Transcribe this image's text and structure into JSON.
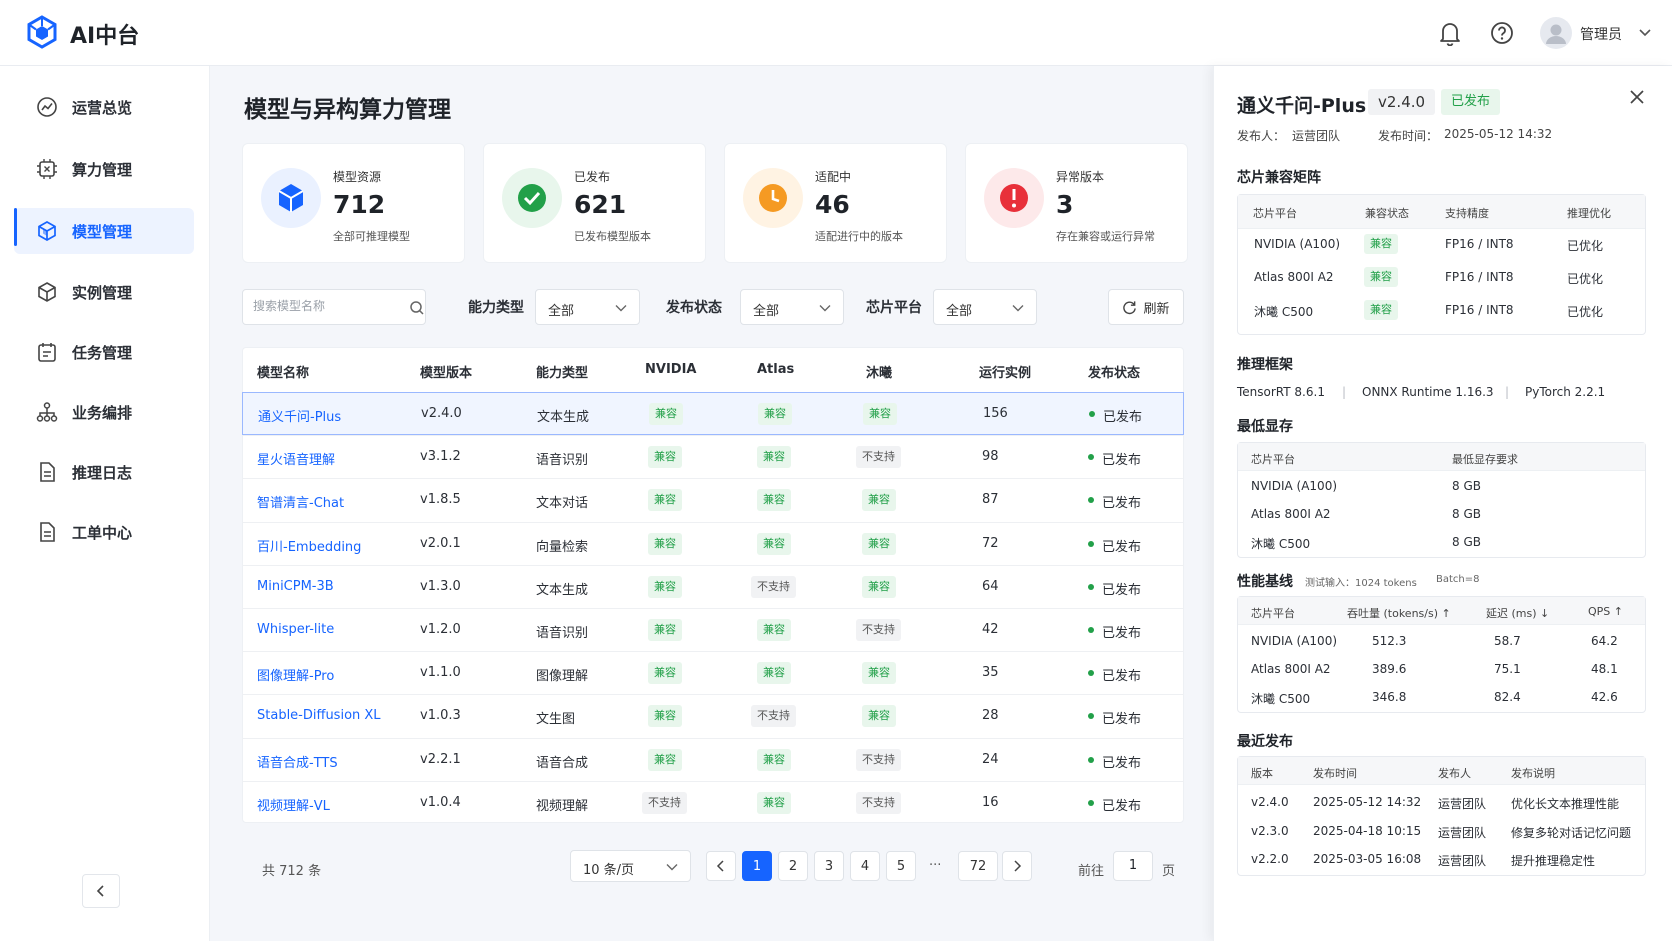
{
  "app": {
    "title": "AI中台"
  },
  "header": {
    "user_name": "管理员"
  },
  "sidebar": {
    "items": [
      {
        "label": "运营总览",
        "icon": "dashboard-icon"
      },
      {
        "label": "算力管理",
        "icon": "chip-icon"
      },
      {
        "label": "模型管理",
        "icon": "model-cube-icon",
        "active": true
      },
      {
        "label": "实例管理",
        "icon": "instance-box-icon"
      },
      {
        "label": "任务管理",
        "icon": "calendar-task-icon"
      },
      {
        "label": "业务编排",
        "icon": "org-chart-icon"
      },
      {
        "label": "推理日志",
        "icon": "document-icon"
      },
      {
        "label": "工单中心",
        "icon": "ticket-icon"
      }
    ]
  },
  "page": {
    "title": "模型与异构算力管理"
  },
  "stats": [
    {
      "label": "模型资源",
      "value": "712",
      "sub": "全部可推理模型",
      "color": "#1664ff",
      "bg": "#eaf1ff"
    },
    {
      "label": "已发布",
      "value": "621",
      "sub": "已发布模型版本",
      "color": "#22a049",
      "bg": "#e8f6ec"
    },
    {
      "label": "适配中",
      "value": "46",
      "sub": "适配进行中的版本",
      "color": "#f59a23",
      "bg": "#fff3e3"
    },
    {
      "label": "异常版本",
      "value": "3",
      "sub": "存在兼容或运行异常",
      "color": "#e8303a",
      "bg": "#fde9ea"
    }
  ],
  "filters": {
    "search_placeholder": "搜索模型名称",
    "ability_label": "能力类型",
    "ability_value": "全部",
    "status_label": "发布状态",
    "status_value": "全部",
    "chip_label": "芯片平台",
    "chip_value": "全部",
    "refresh_label": "刷新"
  },
  "table": {
    "columns": [
      "模型名称",
      "模型版本",
      "能力类型",
      "NVIDIA",
      "Atlas",
      "沐曦",
      "运行实例",
      "发布状态"
    ],
    "rows": [
      {
        "name": "通义千问-Plus",
        "version": "v2.4.0",
        "ability": "文本生成",
        "nvidia": "兼容",
        "atlas": "兼容",
        "muxi": "兼容",
        "instances": "156",
        "status": "已发布"
      },
      {
        "name": "星火语音理解",
        "version": "v3.1.2",
        "ability": "语音识别",
        "nvidia": "兼容",
        "atlas": "兼容",
        "muxi": "不支持",
        "instances": "98",
        "status": "已发布"
      },
      {
        "name": "智谱清言-Chat",
        "version": "v1.8.5",
        "ability": "文本对话",
        "nvidia": "兼容",
        "atlas": "兼容",
        "muxi": "兼容",
        "instances": "87",
        "status": "已发布"
      },
      {
        "name": "百川-Embedding",
        "version": "v2.0.1",
        "ability": "向量检索",
        "nvidia": "兼容",
        "atlas": "兼容",
        "muxi": "兼容",
        "instances": "72",
        "status": "已发布"
      },
      {
        "name": "MiniCPM-3B",
        "version": "v1.3.0",
        "ability": "文本生成",
        "nvidia": "兼容",
        "atlas": "不支持",
        "muxi": "兼容",
        "instances": "64",
        "status": "已发布"
      },
      {
        "name": "Whisper-lite",
        "version": "v1.2.0",
        "ability": "语音识别",
        "nvidia": "兼容",
        "atlas": "兼容",
        "muxi": "不支持",
        "instances": "42",
        "status": "已发布"
      },
      {
        "name": "图像理解-Pro",
        "version": "v1.1.0",
        "ability": "图像理解",
        "nvidia": "兼容",
        "atlas": "兼容",
        "muxi": "兼容",
        "instances": "35",
        "status": "已发布"
      },
      {
        "name": "Stable-Diffusion XL",
        "version": "v1.0.3",
        "ability": "文生图",
        "nvidia": "兼容",
        "atlas": "不支持",
        "muxi": "兼容",
        "instances": "28",
        "status": "已发布"
      },
      {
        "name": "语音合成-TTS",
        "version": "v2.2.1",
        "ability": "语音合成",
        "nvidia": "兼容",
        "atlas": "兼容",
        "muxi": "不支持",
        "instances": "24",
        "status": "已发布"
      },
      {
        "name": "视频理解-VL",
        "version": "v1.0.4",
        "ability": "视频理解",
        "nvidia": "不支持",
        "atlas": "兼容",
        "muxi": "不支持",
        "instances": "16",
        "status": "已发布"
      }
    ]
  },
  "pagination": {
    "total": "共 712 条",
    "page_size": "10 条/页",
    "pages": [
      "1",
      "2",
      "3",
      "4",
      "5"
    ],
    "ellipsis": "···",
    "last": "72",
    "current": "1",
    "goto_label": "前往",
    "goto_value": "1",
    "goto_suffix": "页"
  },
  "panel": {
    "title": "通义千问-Plus",
    "version": "v2.4.0",
    "status": "已发布",
    "publisher_label": "发布人：",
    "publisher": "运营团队",
    "time_label": "发布时间：",
    "time": "2025-05-12 14:32",
    "compat": {
      "title": "芯片兼容矩阵",
      "columns": [
        "芯片平台",
        "兼容状态",
        "支持精度",
        "推理优化"
      ],
      "rows": [
        {
          "chip": "NVIDIA (A100)",
          "status": "兼容",
          "precision": "FP16 / INT8",
          "opt": "已优化"
        },
        {
          "chip": "Atlas 800I A2",
          "status": "兼容",
          "precision": "FP16 / INT8",
          "opt": "已优化"
        },
        {
          "chip": "沐曦 C500",
          "status": "兼容",
          "precision": "FP16 / INT8",
          "opt": "已优化"
        }
      ]
    },
    "frameworks": {
      "title": "推理框架",
      "items": [
        "TensorRT 8.6.1",
        "ONNX Runtime 1.16.3",
        "PyTorch 2.2.1"
      ],
      "separator": "|"
    },
    "memory": {
      "title": "最低显存",
      "columns": [
        "芯片平台",
        "最低显存要求"
      ],
      "rows": [
        {
          "chip": "NVIDIA (A100)",
          "mem": "8 GB"
        },
        {
          "chip": "Atlas 800I A2",
          "mem": "8 GB"
        },
        {
          "chip": "沐曦 C500",
          "mem": "8 GB"
        }
      ]
    },
    "perf": {
      "title": "性能基线",
      "note_input": "测试输入：1024 tokens",
      "note_batch": "Batch=8",
      "columns": [
        "芯片平台",
        "吞吐量 (tokens/s) ↑",
        "延迟 (ms) ↓",
        "QPS ↑"
      ],
      "rows": [
        {
          "chip": "NVIDIA (A100)",
          "throughput": "512.3",
          "latency": "58.7",
          "qps": "64.2"
        },
        {
          "chip": "Atlas 800I A2",
          "throughput": "389.6",
          "latency": "75.1",
          "qps": "48.1"
        },
        {
          "chip": "沐曦 C500",
          "throughput": "346.8",
          "latency": "82.4",
          "qps": "42.6"
        }
      ]
    },
    "releases": {
      "title": "最近发布",
      "columns": [
        "版本",
        "发布时间",
        "发布人",
        "发布说明"
      ],
      "rows": [
        {
          "version": "v2.4.0",
          "time": "2025-05-12 14:32",
          "by": "运营团队",
          "desc": "优化长文本推理性能"
        },
        {
          "version": "v2.3.0",
          "time": "2025-04-18 10:15",
          "by": "运营团队",
          "desc": "修复多轮对话记忆问题"
        },
        {
          "version": "v2.2.0",
          "time": "2025-03-05 16:08",
          "by": "运营团队",
          "desc": "提升推理稳定性"
        }
      ]
    }
  }
}
